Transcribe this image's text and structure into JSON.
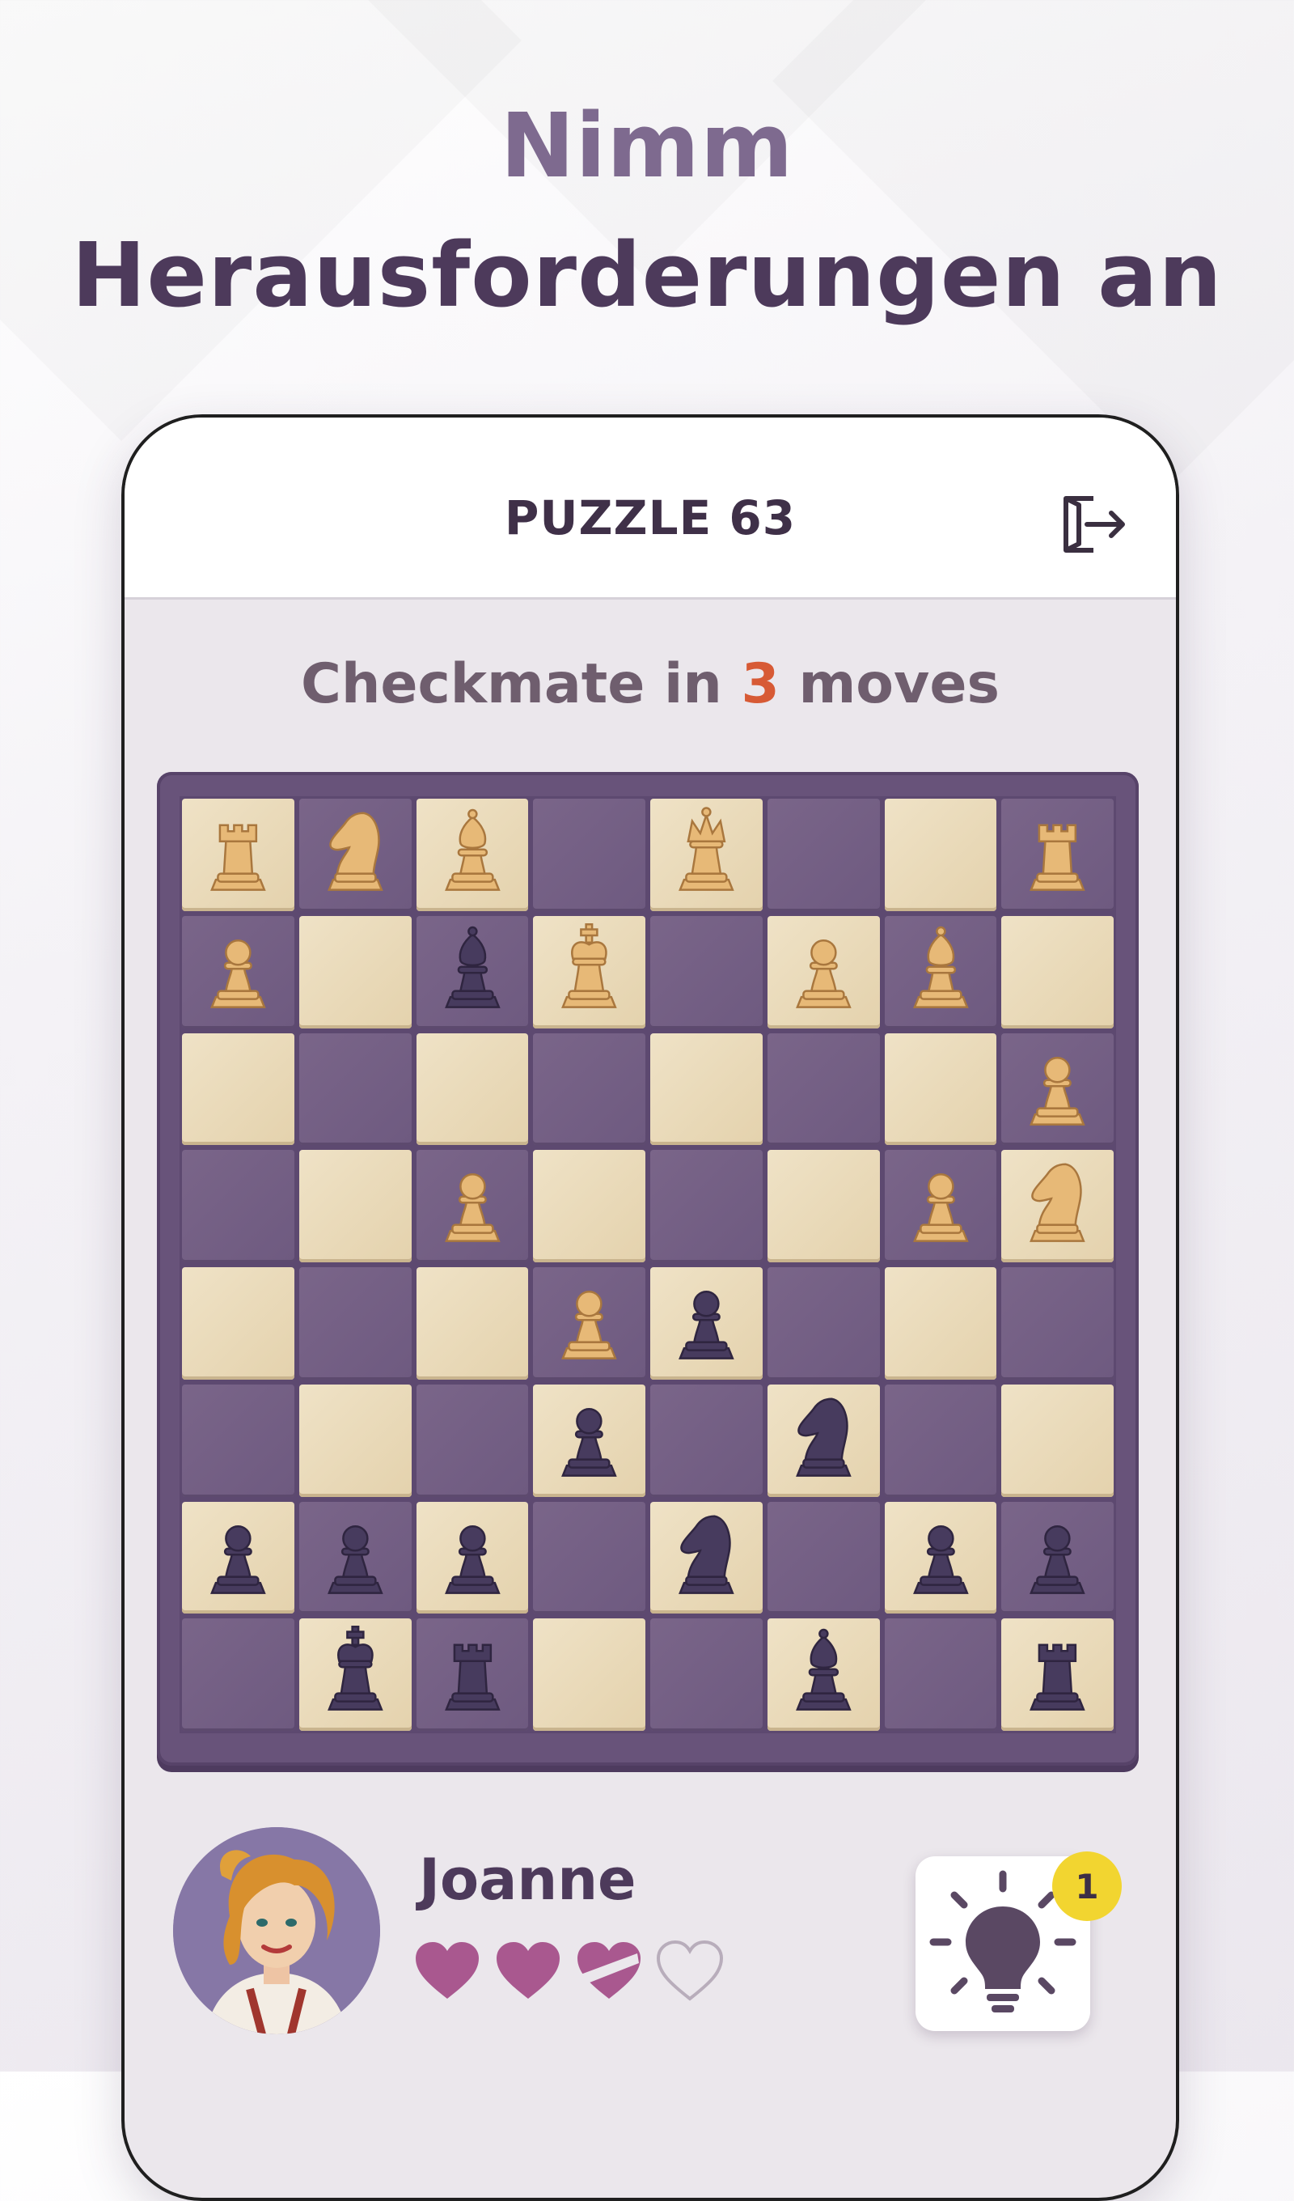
{
  "headline": {
    "line1": "Nimm",
    "line2": "Herausforderungen an"
  },
  "header": {
    "title": "PUZZLE 63",
    "exit_icon": "exit-icon"
  },
  "goal": {
    "prefix": "Checkmate in ",
    "number": "3",
    "suffix": " moves"
  },
  "board": {
    "rows": [
      [
        "wR",
        "wN",
        "wB",
        "",
        "wQ",
        "",
        "",
        "wR"
      ],
      [
        "wP",
        "",
        "bB",
        "wK",
        "",
        "wP",
        "wB",
        ""
      ],
      [
        "",
        "",
        "",
        "",
        "",
        "",
        "",
        "wP"
      ],
      [
        "",
        "",
        "wP",
        "",
        "",
        "",
        "wP",
        "wN"
      ],
      [
        "",
        "",
        "",
        "wP",
        "bP",
        "",
        "",
        ""
      ],
      [
        "",
        "",
        "",
        "bP",
        "",
        "bN",
        "",
        ""
      ],
      [
        "bP",
        "bP",
        "bP",
        "",
        "bN",
        "",
        "bP",
        "bP"
      ],
      [
        "",
        "bK",
        "bR",
        "",
        "",
        "bB",
        "",
        "bR"
      ]
    ]
  },
  "player": {
    "name": "Joanne",
    "avatar_icon": "avatar-portrait",
    "lives": [
      1,
      1,
      0.5,
      0
    ]
  },
  "hint": {
    "icon": "lightbulb-icon",
    "badge": "1"
  },
  "colors": {
    "white_piece": "#e7b977",
    "black_piece": "#473b5e",
    "accent_number": "#d75a35",
    "heart_fill": "#a9588f"
  }
}
